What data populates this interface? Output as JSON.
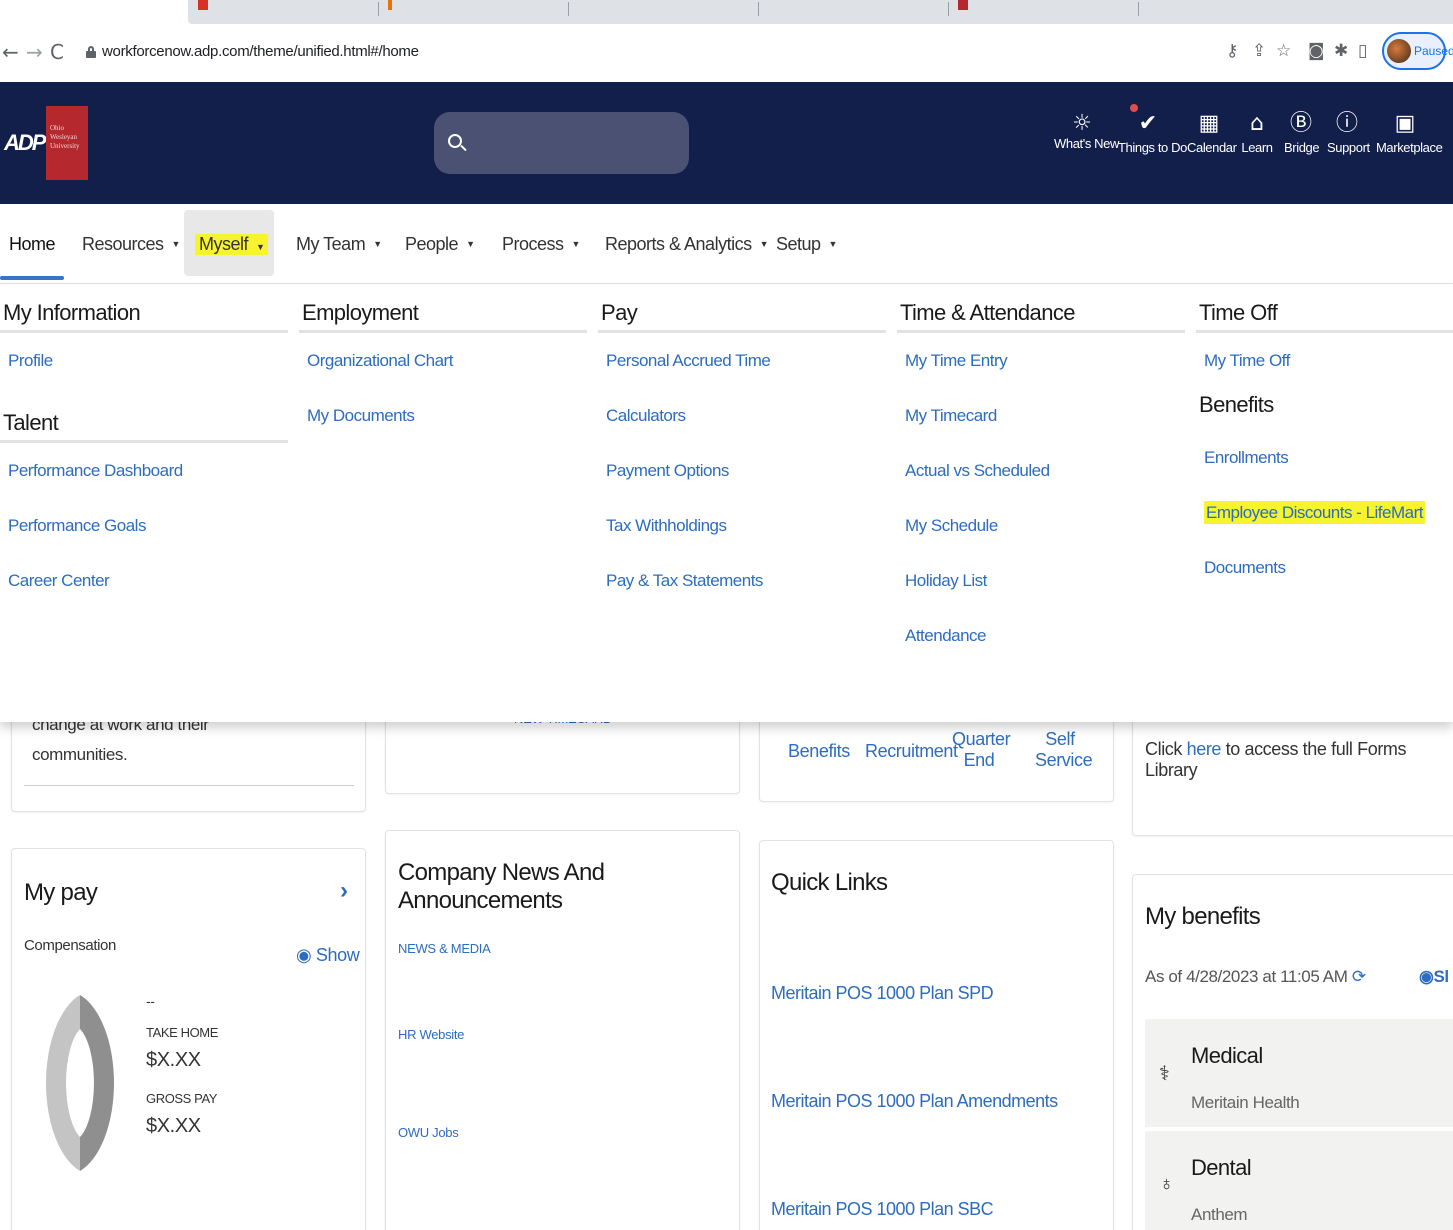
{
  "browser": {
    "url": "workforcenow.adp.com/theme/unified.html#/home",
    "profile_status": "Paused"
  },
  "header": {
    "adp_logo": "ADP",
    "org_logo_text": "Ohio Wesleyan University",
    "tools": [
      {
        "icon": "lightbulb-icon",
        "label": "What's New"
      },
      {
        "icon": "checkmark-badge-icon",
        "label": "Things to Do"
      },
      {
        "icon": "calendar-icon",
        "label": "Calendar"
      },
      {
        "icon": "graduation-cap-icon",
        "label": "Learn"
      },
      {
        "icon": "bridge-icon",
        "label": "Bridge"
      },
      {
        "icon": "support-icon",
        "label": "Support"
      },
      {
        "icon": "marketplace-icon",
        "label": "Marketplace"
      }
    ]
  },
  "nav": {
    "items": [
      "Home",
      "Resources",
      "Myself",
      "My Team",
      "People",
      "Process",
      "Reports & Analytics",
      "Setup"
    ]
  },
  "menu": {
    "my_information": {
      "title": "My Information",
      "links": [
        "Profile"
      ]
    },
    "talent": {
      "title": "Talent",
      "links": [
        "Performance Dashboard",
        "Performance Goals",
        "Career Center"
      ]
    },
    "employment": {
      "title": "Employment",
      "links": [
        "Organizational Chart",
        "My Documents"
      ]
    },
    "pay": {
      "title": "Pay",
      "links": [
        "Personal Accrued Time",
        "Calculators",
        "Payment Options",
        "Tax Withholdings",
        "Pay & Tax Statements"
      ]
    },
    "time_attendance": {
      "title": "Time & Attendance",
      "links": [
        "My Time Entry",
        "My Timecard",
        "Actual vs Scheduled",
        "My Schedule",
        "Holiday List",
        "Attendance"
      ]
    },
    "time_off": {
      "title": "Time Off",
      "links": [
        "My Time Off"
      ]
    },
    "benefits": {
      "title": "Benefits",
      "links": [
        "Enrollments",
        "Employee Discounts - LifeMart",
        "Documents"
      ]
    }
  },
  "content": {
    "card1_text_line1": "change at work and their",
    "card1_text_line2": "communities.",
    "card2_partial": "NEW TIMECARD",
    "services": [
      "Benefits",
      "Recruitment",
      "Quarter End",
      "Self Service"
    ],
    "forms_text_before": "Click ",
    "forms_link": "here",
    "forms_text_after": " to access the full Forms Library",
    "my_pay": {
      "title": "My pay",
      "compensation": "Compensation",
      "show": "Show",
      "dash": "--",
      "take_home_label": "TAKE HOME",
      "take_home_value": "$X.XX",
      "gross_pay_label": "GROSS PAY",
      "gross_pay_value": "$X.XX"
    },
    "news": {
      "title": "Company News And Announcements",
      "links": [
        "NEWS & MEDIA",
        "HR Website",
        "OWU Jobs"
      ]
    },
    "quick_links": {
      "title": "Quick Links",
      "links": [
        "Meritain POS 1000 Plan SPD",
        "Meritain POS 1000 Plan Amendments",
        "Meritain POS 1000 Plan SBC"
      ]
    },
    "my_benefits": {
      "title": "My benefits",
      "as_of": "As of 4/28/2023 at 11:05 AM",
      "show_partial": "Sl",
      "items": [
        {
          "name": "Medical",
          "provider": "Meritain Health",
          "icon": "stethoscope-icon"
        },
        {
          "name": "Dental",
          "provider": "Anthem",
          "icon": "tooth-icon"
        }
      ]
    }
  },
  "colors": {
    "header_bg": "#121f4a",
    "link": "#2d6cc0",
    "highlight": "#f7f32e",
    "owu_red": "#b5282e"
  }
}
